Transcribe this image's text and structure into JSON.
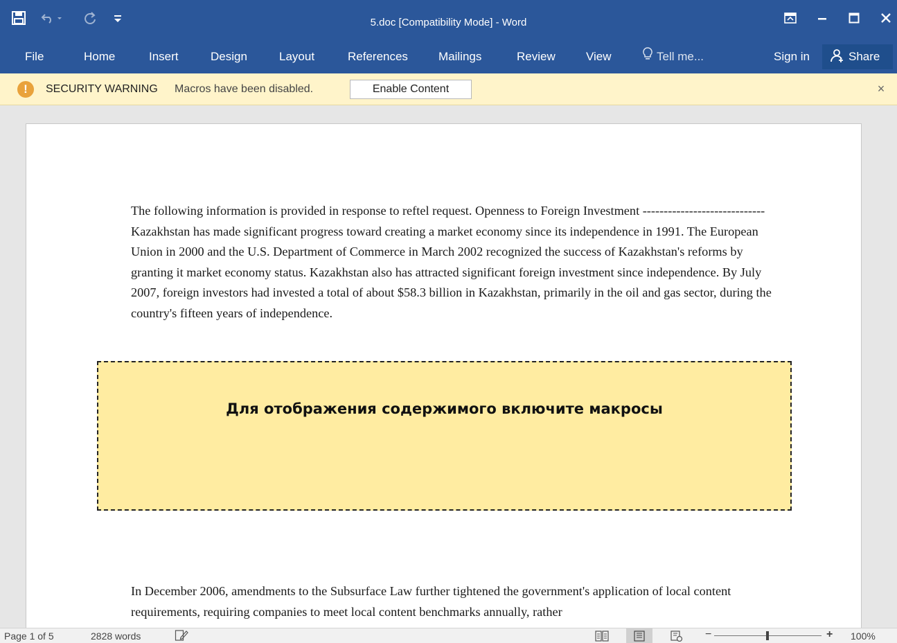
{
  "window": {
    "title": "5.doc [Compatibility Mode] - Word"
  },
  "qat": {
    "save_icon": "save-icon",
    "undo_icon": "undo-icon",
    "redo_icon": "redo-icon",
    "customize_icon": "customize-qat-icon"
  },
  "ribbon": {
    "tabs": [
      "File",
      "Home",
      "Insert",
      "Design",
      "Layout",
      "References",
      "Mailings",
      "Review",
      "View"
    ],
    "tell_me": "Tell me...",
    "sign_in": "Sign in",
    "share": "Share"
  },
  "security_bar": {
    "label": "SECURITY WARNING",
    "message": "Macros have been disabled.",
    "button": "Enable Content",
    "close": "×"
  },
  "document": {
    "paragraph1": "The following information is provided in response to reftel request. Openness to Foreign Investment ----------------------------- Kazakhstan has made significant progress toward creating a market economy since its independence in 1991. The European Union in 2000 and the U.S. Department of Commerce in March 2002 recognized the success of Kazakhstan's reforms by granting it market economy status. Kazakhstan also has attracted significant foreign investment since independence. By July 2007, foreign investors had invested a total of about $58.3 billion in Kazakhstan, primarily in the oil and gas sector, during the country's fifteen years of independence.",
    "macro_notice": "Для отображения содержимого включите макросы",
    "paragraph2": " In December 2006, amendments to the Subsurface Law further tightened the government's application of local content requirements, requiring companies to meet local content benchmarks annually, rather"
  },
  "statusbar": {
    "page": "Page 1 of 5",
    "words": "2828 words",
    "zoom_minus": "−",
    "zoom_plus": "+",
    "zoom": "100%",
    "zoom_level": 1.0
  },
  "colors": {
    "titlebar": "#2b579a",
    "security_bar": "#fff4ca",
    "macro_box": "#ffeca1"
  }
}
